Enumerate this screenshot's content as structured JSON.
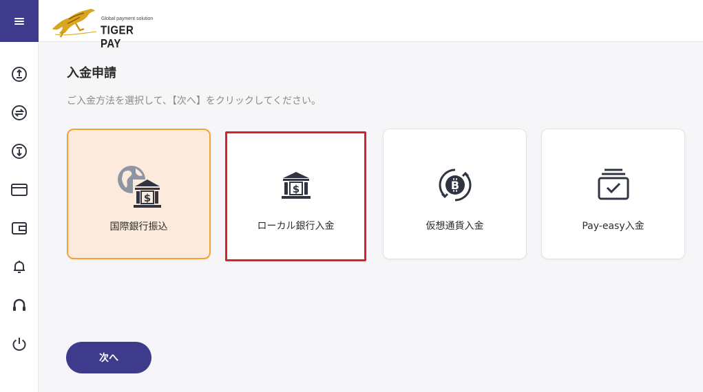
{
  "header": {
    "brand_name": "TIGER PAY",
    "brand_tagline": "Global payment solution",
    "menu_icon": "menu-icon"
  },
  "sidebar": {
    "items": [
      {
        "icon": "deposit-icon"
      },
      {
        "icon": "transfer-icon"
      },
      {
        "icon": "withdraw-icon"
      },
      {
        "icon": "card-icon"
      },
      {
        "icon": "wallet-icon"
      },
      {
        "icon": "bell-icon"
      },
      {
        "icon": "headset-icon"
      },
      {
        "icon": "power-icon"
      }
    ]
  },
  "main": {
    "title": "入金申請",
    "description": "ご入金方法を選択して、【次へ】をクリックしてください。",
    "options": [
      {
        "label": "国際銀行振込",
        "icon": "globe-bank-icon",
        "state": "selected"
      },
      {
        "label": "ローカル銀行入金",
        "icon": "bank-icon",
        "state": "highlighted"
      },
      {
        "label": "仮想通貨入金",
        "icon": "bitcoin-icon",
        "state": "normal"
      },
      {
        "label": "Pay-easy入金",
        "icon": "check-tray-icon",
        "state": "normal"
      }
    ],
    "next_label": "次へ"
  },
  "colors": {
    "primary": "#3f3b8c",
    "selected_bg": "#fcebdc",
    "selected_border": "#f2a431",
    "highlight_border": "#d9212c",
    "icon_dark": "#2f3440"
  }
}
